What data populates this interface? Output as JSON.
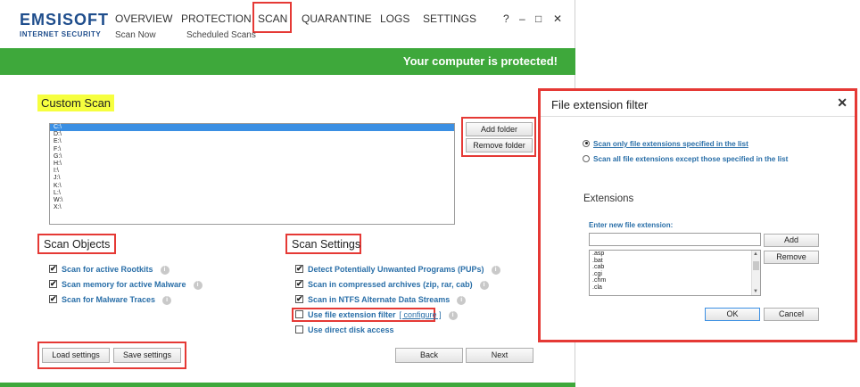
{
  "app": {
    "logo_main": "EMSISOFT",
    "logo_sub": "INTERNET SECURITY"
  },
  "nav": {
    "items": [
      "OVERVIEW",
      "PROTECTION",
      "SCAN",
      "QUARANTINE",
      "LOGS",
      "SETTINGS"
    ],
    "sub_items": [
      "Scan Now",
      "Scheduled Scans"
    ]
  },
  "window_controls": {
    "help": "?",
    "minimize": "–",
    "maximize": "□",
    "close": "✕"
  },
  "status": {
    "text": "Your computer is protected!"
  },
  "custom_scan": {
    "title": "Custom Scan",
    "drives": [
      "C:\\",
      "D:\\",
      "E:\\",
      "F:\\",
      "G:\\",
      "H:\\",
      "I:\\",
      "J:\\",
      "K:\\",
      "L:\\",
      "W:\\",
      "X:\\"
    ],
    "selected_index": 0,
    "add_folder": "Add folder",
    "remove_folder": "Remove folder"
  },
  "scan_objects": {
    "title": "Scan Objects",
    "options": [
      {
        "label": "Scan for active Rootkits",
        "checked": true
      },
      {
        "label": "Scan memory for active Malware",
        "checked": true
      },
      {
        "label": "Scan for Malware Traces",
        "checked": true
      }
    ]
  },
  "scan_settings": {
    "title": "Scan Settings",
    "options": [
      {
        "label": "Detect Potentially Unwanted Programs (PUPs)",
        "checked": true
      },
      {
        "label": "Scan in compressed archives (zip, rar, cab)",
        "checked": true
      },
      {
        "label": "Scan in NTFS Alternate Data Streams",
        "checked": true
      },
      {
        "label": "Use file extension filter",
        "checked": false
      },
      {
        "label": "Use direct disk access",
        "checked": false
      }
    ],
    "configure_link": "[ configure ]"
  },
  "footer": {
    "load_settings": "Load settings",
    "save_settings": "Save settings",
    "back": "Back",
    "next": "Next"
  },
  "dialog": {
    "title": "File extension filter",
    "close": "✕",
    "radio_only": "Scan only file extensions specified in the list",
    "radio_except": "Scan all file extensions except those specified in the list",
    "extensions_heading": "Extensions",
    "new_ext_label": "Enter new file extension:",
    "new_ext_value": "",
    "add": "Add",
    "remove": "Remove",
    "extensions": [
      ".asp",
      ".bat",
      ".cab",
      ".cgi",
      ".chm",
      ".cla"
    ],
    "ok": "OK",
    "cancel": "Cancel"
  },
  "colors": {
    "accent_green": "#3ea83b",
    "highlight_red": "#e53935",
    "brand_blue": "#1e4d8c",
    "link_blue": "#2a6fa8"
  }
}
